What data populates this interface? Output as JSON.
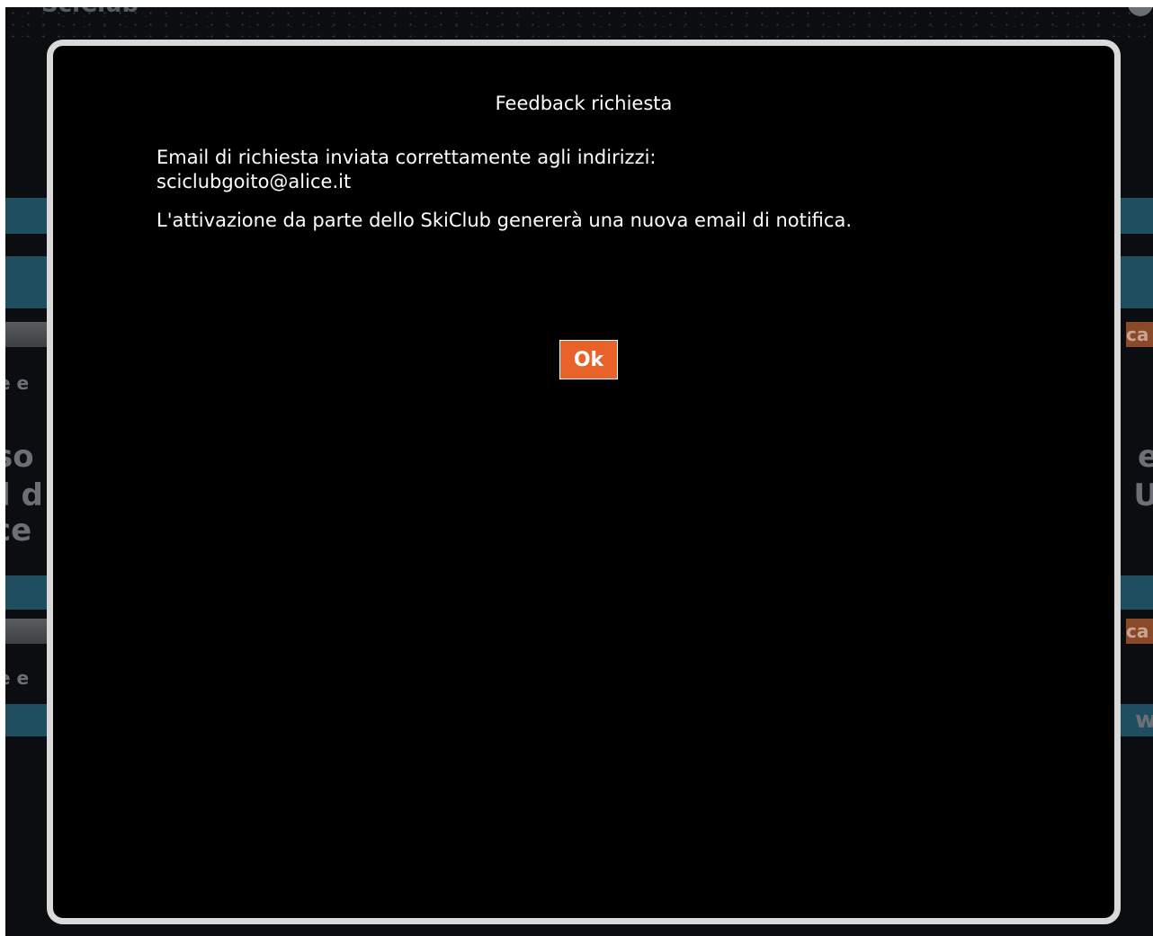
{
  "background": {
    "top_text": "SciClub",
    "left_fragments": [
      "e e",
      "so",
      "l d",
      "ce",
      "e e"
    ],
    "right_fragments": [
      "ca",
      "e",
      "U",
      "ca",
      "w"
    ]
  },
  "dialog": {
    "title": "Feedback richiesta",
    "message_line1": "Email di richiesta inviata correttamente agli indirizzi:",
    "email": "sciclubgoito@alice.it",
    "message_line2": "L'attivazione da parte dello SkiClub genererà una nuova email di notifica.",
    "ok_label": "Ok"
  },
  "colors": {
    "ok_button": "#e8622a",
    "dialog_background": "#000000",
    "dialog_border": "#d9d9d9",
    "background_bars": "#1e4e60"
  }
}
